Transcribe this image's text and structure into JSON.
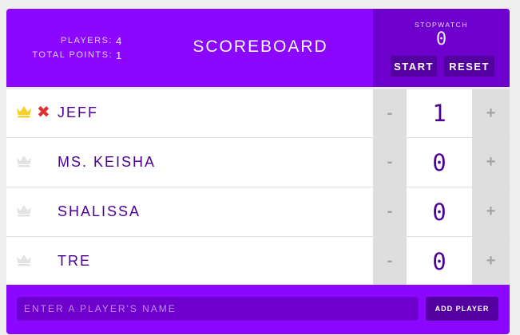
{
  "header": {
    "stats": {
      "players_label": "PLAYERS:",
      "players_value": "4",
      "total_points_label": "TOTAL POINTS:",
      "total_points_value": "1"
    },
    "title": "SCOREBOARD",
    "stopwatch": {
      "label": "STOPWATCH",
      "time": "0",
      "start_label": "START",
      "reset_label": "RESET"
    }
  },
  "players": [
    {
      "name": "JEFF",
      "score": "1",
      "leader": true,
      "show_remove": true,
      "crown_icon": "crown-icon",
      "remove_icon": "close-icon"
    },
    {
      "name": "MS. KEISHA",
      "score": "0",
      "leader": false,
      "show_remove": false,
      "crown_icon": "crown-icon"
    },
    {
      "name": "SHALISSA",
      "score": "0",
      "leader": false,
      "show_remove": false,
      "crown_icon": "crown-icon"
    },
    {
      "name": "TRE",
      "score": "0",
      "leader": false,
      "show_remove": false,
      "crown_icon": "crown-icon"
    }
  ],
  "counter": {
    "decrement_label": "-",
    "increment_label": "+"
  },
  "remove_symbol": "✖",
  "add_player": {
    "placeholder": "ENTER A PLAYER'S NAME",
    "button_label": "ADD PLAYER"
  },
  "colors": {
    "primary": "#8c07ff",
    "dark_primary": "#6e00cd",
    "button": "#5400a0",
    "crown_active": "#f5cf2b",
    "crown_inactive": "#e3e3e3",
    "remove": "#e03131",
    "text": "#4d0194"
  }
}
